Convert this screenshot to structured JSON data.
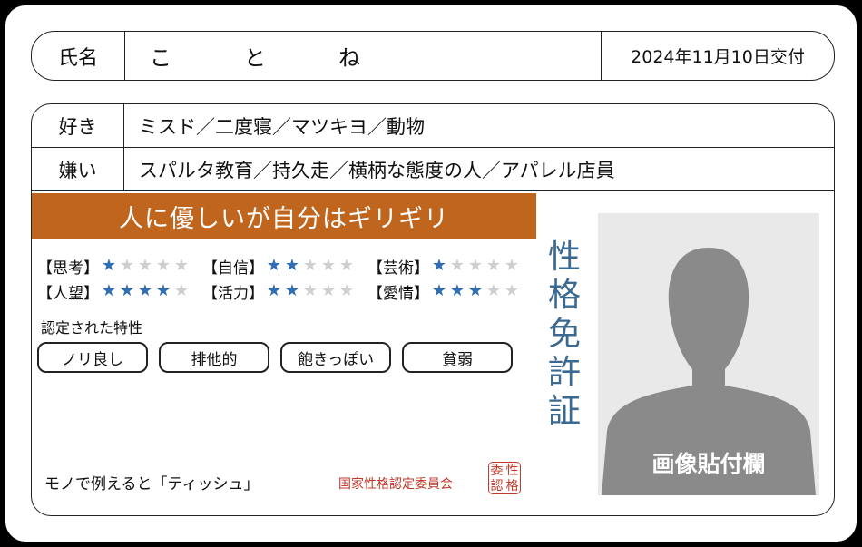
{
  "header": {
    "name_label": "氏名",
    "name": "ことね",
    "issue_date": "2024年11月10日交付"
  },
  "likes": {
    "label": "好き",
    "value": "ミスド／二度寝／マツキヨ／動物"
  },
  "dislikes": {
    "label": "嫌い",
    "value": "スパルタ教育／持久走／横柄な態度の人／アパレル店員"
  },
  "banner": "人に優しいが自分はギリギリ",
  "stats": [
    {
      "label": "【思考】",
      "rating": 1,
      "max": 5
    },
    {
      "label": "【自信】",
      "rating": 2,
      "max": 5
    },
    {
      "label": "【芸術】",
      "rating": 1,
      "max": 5
    },
    {
      "label": "【人望】",
      "rating": 4,
      "max": 5
    },
    {
      "label": "【活力】",
      "rating": 2,
      "max": 5
    },
    {
      "label": "【愛情】",
      "rating": 3,
      "max": 5
    }
  ],
  "traits_heading": "認定された特性",
  "traits": [
    "ノリ良し",
    "排他的",
    "飽きっぽい",
    "貧弱"
  ],
  "vertical_title": "性格免許証",
  "photo_label": "画像貼付欄",
  "example": "モノで例えると「ティッシュ」",
  "issuer": "国家性格認定委員会",
  "seal": "性格認定委",
  "colors": {
    "banner": "#C0651E",
    "star_on": "#2F6DB5",
    "star_off": "#CFCFCF",
    "title": "#3A6A92",
    "issuer": "#C0392B"
  }
}
